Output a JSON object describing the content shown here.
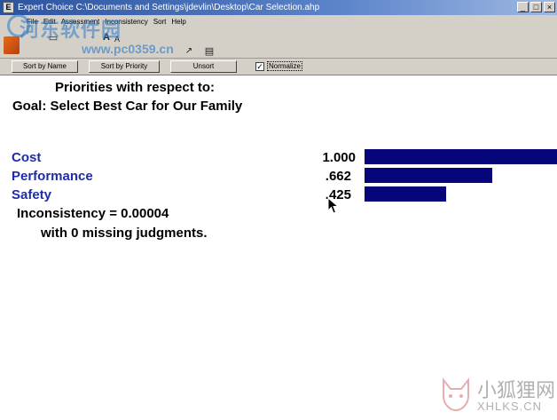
{
  "window": {
    "title": "Expert Choice    C:\\Documents and Settings\\jdevlin\\Desktop\\Car Selection.ahp",
    "controls": [
      "_",
      "□",
      "×"
    ]
  },
  "menu": {
    "items": [
      "File",
      "Edit",
      "Assessment",
      "Inconsistency",
      "Sort",
      "Help"
    ]
  },
  "watermark": {
    "cn": "河东软件园",
    "site": "www.pc0359.cn",
    "bottom_cn": "小狐狸网",
    "bottom_en": "XHLKS.CN"
  },
  "sortbar": {
    "sort_by_name": "Sort by Name",
    "sort_by_priority": "Sort by Priority",
    "unsort": "Unsort",
    "normalize_label": "Normalize",
    "normalize_checked": "✓"
  },
  "report": {
    "header_line1": "Priorities with respect to:",
    "header_line2": "Goal: Select Best Car for Our Family",
    "criteria": [
      {
        "name": "Cost",
        "value_label": "1.000",
        "value": 1.0
      },
      {
        "name": "Performance",
        "value_label": ".662",
        "value": 0.662
      },
      {
        "name": "Safety",
        "value_label": ".425",
        "value": 0.425
      }
    ],
    "inconsistency": "Inconsistency = 0.00004",
    "missing": "with 0  missing judgments."
  },
  "colors": {
    "bar": "#06057a",
    "criteria_text": "#1f2ca8"
  }
}
